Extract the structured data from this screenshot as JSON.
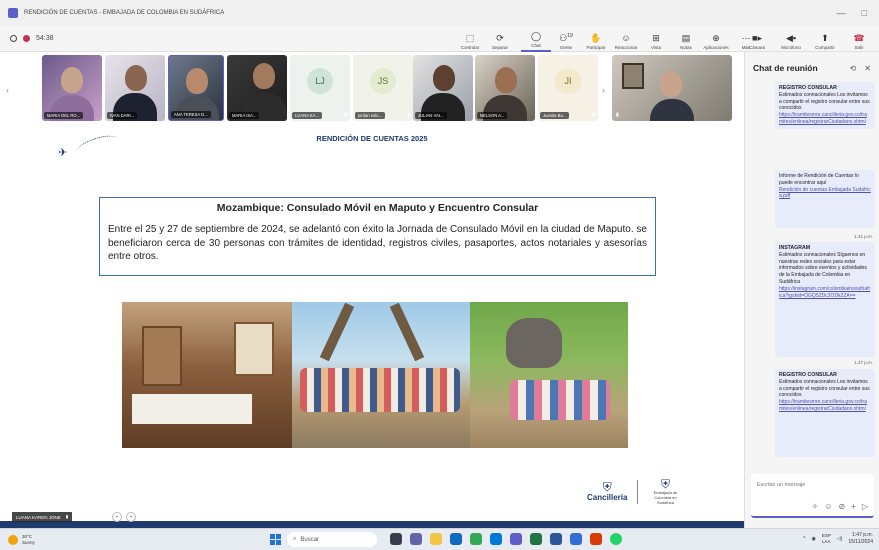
{
  "window": {
    "title": "RENDICIÓN DE CUENTAS - EMBAJADA DE COLOMBIA EN SUDÁFRICA",
    "controls": [
      "—",
      "□"
    ]
  },
  "meeting": {
    "timer": "54:38"
  },
  "toolbar": {
    "buttons": [
      {
        "label": "Controlar",
        "icon": "control-icon"
      },
      {
        "label": "Separar",
        "icon": "detach-icon"
      },
      {
        "label": "Chat",
        "icon": "chat-icon"
      },
      {
        "label": "Gente",
        "icon": "people-icon",
        "badge": "19"
      },
      {
        "label": "Participar",
        "icon": "raise-hand-icon"
      },
      {
        "label": "Reaccionar",
        "icon": "react-icon"
      },
      {
        "label": "Vista",
        "icon": "view-icon"
      },
      {
        "label": "Notas",
        "icon": "notes-icon"
      },
      {
        "label": "Aplicaciones",
        "icon": "apps-icon"
      },
      {
        "label": "Más",
        "icon": "more-icon"
      },
      {
        "label": "Cámara",
        "icon": "camera-icon"
      },
      {
        "label": "Micrófono",
        "icon": "mic-icon"
      },
      {
        "label": "Compartir",
        "icon": "share-icon"
      },
      {
        "label": "Salir",
        "icon": "leave-icon"
      }
    ]
  },
  "participants": [
    {
      "name": "MARIA DEL RO...",
      "type": "video"
    },
    {
      "name": "IVAN DARI...",
      "type": "video"
    },
    {
      "name": "ANA TERESA D...",
      "type": "video"
    },
    {
      "name": "MARIA ISA...",
      "type": "video"
    },
    {
      "name": "LUANA KA...",
      "type": "initials",
      "initials": "LJ",
      "color": "#cfe3dc"
    },
    {
      "name": "jordan solo...",
      "type": "initials",
      "initials": "JS",
      "color": "#e3ecd1"
    },
    {
      "name": "JULIAN VAI...",
      "type": "video"
    },
    {
      "name": "NELSON A...",
      "type": "video"
    },
    {
      "name": "Juanita Ba...",
      "type": "initials",
      "initials": "JI",
      "color": "#f3e9cc"
    },
    {
      "name": "",
      "type": "video"
    }
  ],
  "slide": {
    "header": "RENDICIÓN DE CUENTAS 2025",
    "title": "Mozambique: Consulado Móvil en Maputo y Encuentro Consular",
    "body": "Entre el 25 y 27 de septiembre de 2024, se adelantó con éxito la Jornada de Consulado Móvil en la ciudad de Maputo. se beneficiaron cerca de 30 personas con trámites de identidad, registros civiles, pasaportes, actos notariales y asesorías entre otros.",
    "brand": "Cancillería",
    "brand_sub": "Embajada de Colombia en Sudáfrica"
  },
  "self_view": {
    "name": "LUANA KAREN JONE"
  },
  "chat": {
    "title": "Chat de reunión",
    "messages": [
      {
        "heading": "REGISTRO CONSULAR",
        "text": "Estimados connacionales Los invitamos a compartir el registro consular entre sus conocidos",
        "link": "https://tramitesmre.cancilleria.gov.co/tramites/enlinea/registrarCiudadano.xhtml"
      },
      {
        "heading": "",
        "text": "Informe de Rendición de Cuentas lo puede encontrar aquí",
        "link": "Rendición de cuentas Embajada Sudáfrica.pdf"
      },
      {
        "time": "1:41 p.m.",
        "heading": "INSTAGRAM",
        "text": "Estimados connacionales Síguenos en nuestras redes sociales para estar informados sobre eventos y actividades de la Embajada de Colombia en Sudáfrica",
        "link": "https://instagram.com/colombiainsouthafrica?igshid=OGQ5ZDc2ODk2ZA=="
      },
      {
        "time": "1:47 p.m.",
        "heading": "REGISTRO CONSULAR",
        "text": "Estimados connacionales Los invitamos a compartir el registro consular entre sus conocidos",
        "link": "https://tramitesmre.cancilleria.gov.co/tramites/enlinea/registrarCiudadano.xhtml"
      }
    ],
    "compose_placeholder": "Escribe un mensaje"
  },
  "taskbar": {
    "weather_temp": "30°C",
    "weather_desc": "Sunny",
    "search_placeholder": "Buscar",
    "lang": "ESP",
    "lang2": "LAA",
    "time": "1:47 p.m.",
    "date": "15/11/2024"
  },
  "colors": {
    "accent": "#5b5fc7",
    "navy": "#1f3b6e",
    "leave": "#c4314b"
  }
}
